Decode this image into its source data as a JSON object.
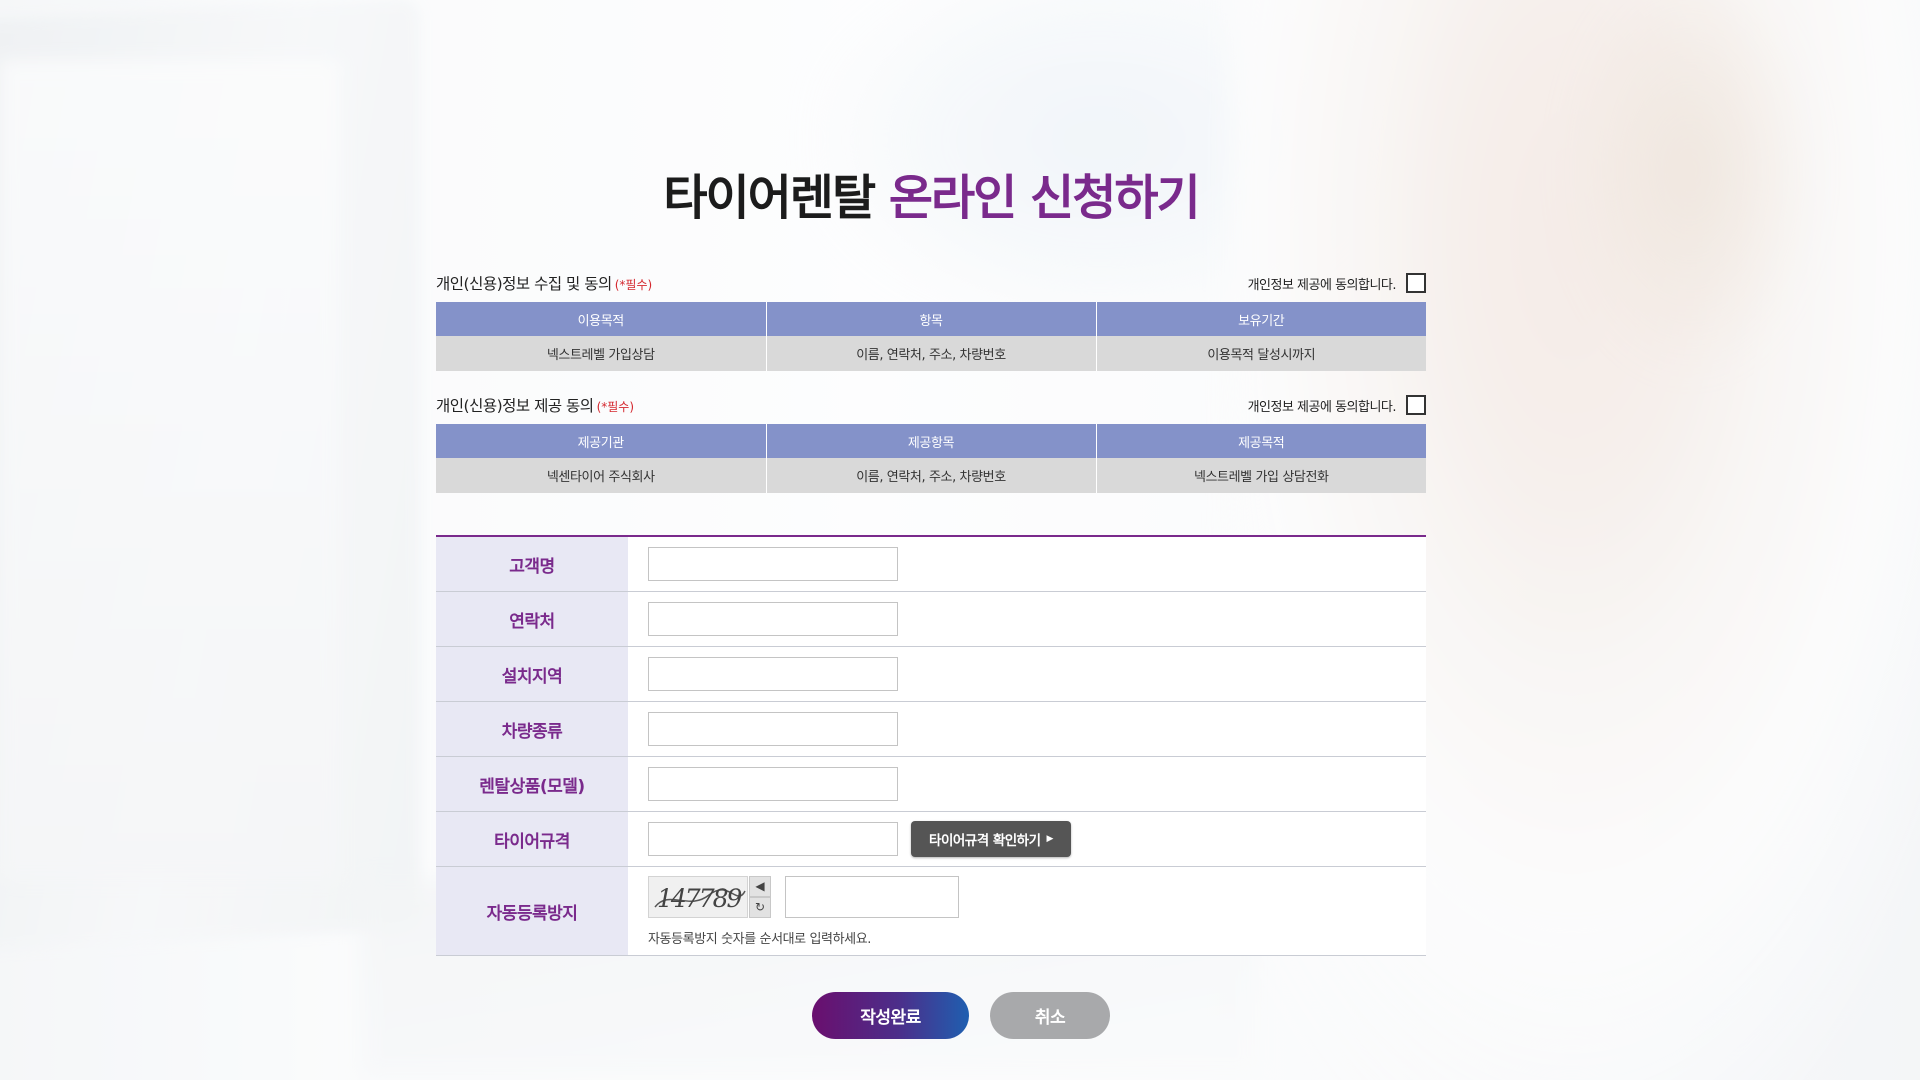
{
  "title": {
    "part1": "타이어렌탈",
    "part2": "온라인 신청하기"
  },
  "section1": {
    "label": "개인(신용)정보 수집 및 동의",
    "required": "(*필수)",
    "agree_label": "개인정보 제공에 동의합니다.",
    "headers": [
      "이용목적",
      "항목",
      "보유기간"
    ],
    "row": [
      "넥스트레벨 가입상담",
      "이름, 연락처, 주소, 차량번호",
      "이용목적 달성시까지"
    ]
  },
  "section2": {
    "label": "개인(신용)정보 제공 동의",
    "required": "(*필수)",
    "agree_label": "개인정보 제공에 동의합니다.",
    "headers": [
      "제공기관",
      "제공항목",
      "제공목적"
    ],
    "row": [
      "넥센타이어 주식회사",
      "이름, 연락처, 주소, 차량번호",
      "넥스트레벨 가입 상담전화"
    ]
  },
  "form": {
    "fields": [
      {
        "label": "고객명",
        "value": ""
      },
      {
        "label": "연락처",
        "value": ""
      },
      {
        "label": "설치지역",
        "value": ""
      },
      {
        "label": "차량종류",
        "value": ""
      },
      {
        "label": "렌탈상품(모델)",
        "value": ""
      },
      {
        "label": "타이어규격",
        "value": ""
      }
    ],
    "spec_button": "타이어규격 확인하기",
    "captcha_label": "자동등록방지",
    "captcha_text": "147789",
    "captcha_help": "자동등록방지 숫자를 순서대로 입력하세요."
  },
  "buttons": {
    "submit": "작성완료",
    "cancel": "취소"
  },
  "colors": {
    "accent": "#7a2a8c",
    "table_header": "#8492c9",
    "submit_start": "#6a0f6e",
    "submit_end": "#1f5fb0",
    "cancel": "#a8a9ab"
  },
  "icons": {
    "sound": "speaker-icon",
    "refresh": "refresh-icon",
    "arrow": "caret-right-icon"
  }
}
